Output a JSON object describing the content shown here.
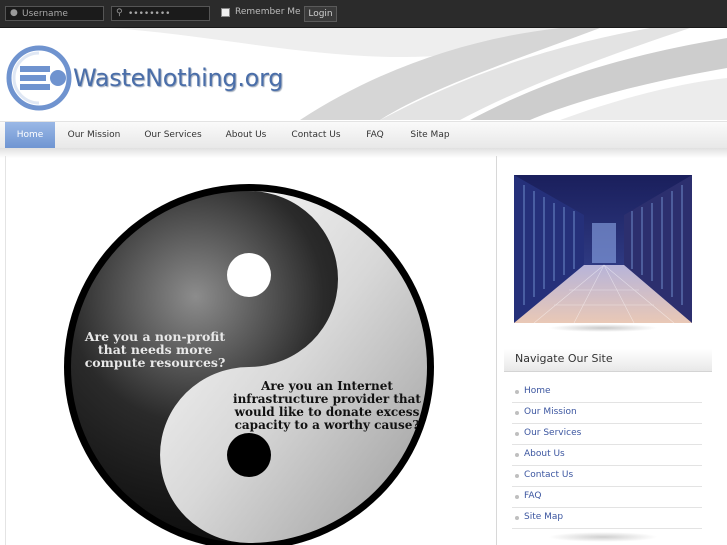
{
  "login_bar": {
    "username_placeholder": "Username",
    "password_value": "••••••••",
    "remember_label": "Remember Me",
    "login_button": "Login"
  },
  "header": {
    "site_name": "WasteNothing.org",
    "brand_color": "#4a6ea9"
  },
  "nav": {
    "items": [
      {
        "label": "Home",
        "active": true
      },
      {
        "label": "Our Mission",
        "active": false
      },
      {
        "label": "Our Services",
        "active": false
      },
      {
        "label": "About Us",
        "active": false
      },
      {
        "label": "Contact Us",
        "active": false
      },
      {
        "label": "FAQ",
        "active": false
      },
      {
        "label": "Site Map",
        "active": false
      }
    ],
    "active_color": "#7a9ed8"
  },
  "main": {
    "yinyang_text_top": [
      "Are you a non-profit",
      "that needs more",
      "compute resources?"
    ],
    "yinyang_text_bottom": [
      "Are you an Internet",
      "infrastructure provider that",
      "would like to donate excess",
      "capacity to a worthy cause?"
    ]
  },
  "sidebar": {
    "title": "Navigate Our Site",
    "items": [
      "Home",
      "Our Mission",
      "Our Services",
      "About Us",
      "Contact Us",
      "FAQ",
      "Site Map"
    ],
    "link_color": "#3c56a0"
  }
}
